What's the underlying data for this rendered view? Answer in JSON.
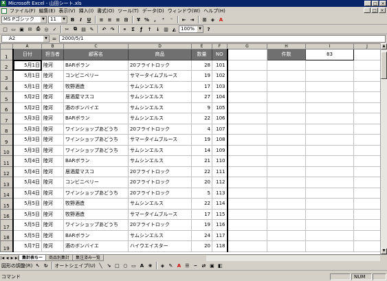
{
  "window": {
    "title": "Microsoft Excel - 山田シート.xls",
    "app_icon": "X"
  },
  "menu": [
    "ファイル(F)",
    "編集(E)",
    "表示(V)",
    "挿入(I)",
    "書式(O)",
    "ツール(T)",
    "データ(D)",
    "ウィンドウ(W)",
    "ヘルプ(H)"
  ],
  "toolbar": {
    "font_name": "MS Pゴシック",
    "font_size": "11",
    "bold": "B",
    "italic": "I",
    "underline": "U",
    "zoom": "100%"
  },
  "formula": {
    "name_box": "A2",
    "eq": "=",
    "value": "2000/5/1"
  },
  "columns": [
    "A",
    "B",
    "C",
    "D",
    "E",
    "F",
    "G",
    "H",
    "I",
    "J"
  ],
  "headers": {
    "date": "日付",
    "staff": "担当者",
    "customer": "顧客名",
    "product": "商品",
    "qty": "数量",
    "no": "NO"
  },
  "summary": {
    "label": "件数",
    "value": "83"
  },
  "rows": [
    {
      "r": "1"
    },
    {
      "r": "2",
      "date": "5月1日",
      "staff": "陸河",
      "customer": "BARボラン",
      "product": "20フライトロック",
      "qty": "28",
      "no": "101"
    },
    {
      "r": "3",
      "date": "5月1日",
      "staff": "陸河",
      "customer": "コンビニベリー",
      "product": "サマータイムブルース",
      "qty": "19",
      "no": "102"
    },
    {
      "r": "4",
      "date": "5月1日",
      "staff": "陸河",
      "customer": "牧野酒造",
      "product": "サムシンエルス",
      "qty": "17",
      "no": "103"
    },
    {
      "r": "5",
      "date": "5月2日",
      "staff": "陸河",
      "customer": "居酒屋マスコ",
      "product": "サムシンエルス",
      "qty": "27",
      "no": "104"
    },
    {
      "r": "6",
      "date": "5月2日",
      "staff": "陸河",
      "customer": "酒のボンバイエ",
      "product": "サムシンエルス",
      "qty": "9",
      "no": "105"
    },
    {
      "r": "7",
      "date": "5月3日",
      "staff": "陸河",
      "customer": "BARボラン",
      "product": "サムシンエルス",
      "qty": "22",
      "no": "106"
    },
    {
      "r": "8",
      "date": "5月3日",
      "staff": "陸河",
      "customer": "ワインショップあどうち",
      "product": "20フライトロック",
      "qty": "4",
      "no": "107"
    },
    {
      "r": "9",
      "date": "5月3日",
      "staff": "陸河",
      "customer": "ワインショップあどうち",
      "product": "サマータイムブルース",
      "qty": "19",
      "no": "108"
    },
    {
      "r": "10",
      "date": "5月3日",
      "staff": "陸河",
      "customer": "ワインショップあどうち",
      "product": "サムシンエルス",
      "qty": "14",
      "no": "109"
    },
    {
      "r": "11",
      "date": "5月4日",
      "staff": "陸河",
      "customer": "BARボラン",
      "product": "サムシンエルス",
      "qty": "21",
      "no": "110"
    },
    {
      "r": "12",
      "date": "5月4日",
      "staff": "陸河",
      "customer": "居酒屋マスコ",
      "product": "20フライトロック",
      "qty": "22",
      "no": "111"
    },
    {
      "r": "13",
      "date": "5月4日",
      "staff": "陸河",
      "customer": "コンビニベリー",
      "product": "20フライトロック",
      "qty": "20",
      "no": "112"
    },
    {
      "r": "14",
      "date": "5月4日",
      "staff": "陸河",
      "customer": "ワインショップあどうち",
      "product": "20フライトロック",
      "qty": "5",
      "no": "113"
    },
    {
      "r": "15",
      "date": "5月5日",
      "staff": "陸河",
      "customer": "牧野酒造",
      "product": "サムシンエルス",
      "qty": "22",
      "no": "114"
    },
    {
      "r": "16",
      "date": "5月5日",
      "staff": "陸河",
      "customer": "牧野酒造",
      "product": "サマータイムブルース",
      "qty": "17",
      "no": "115"
    },
    {
      "r": "17",
      "date": "5月5日",
      "staff": "陸河",
      "customer": "ワインショップあどうち",
      "product": "20フライトロック",
      "qty": "19",
      "no": "116"
    },
    {
      "r": "18",
      "date": "5月5日",
      "staff": "陸河",
      "customer": "BARボラン",
      "product": "サムシンエルス",
      "qty": "24",
      "no": "117"
    },
    {
      "r": "19",
      "date": "5月7日",
      "staff": "陸河",
      "customer": "酒のボンバイエ",
      "product": "ハイウエイスター",
      "qty": "20",
      "no": "118"
    }
  ],
  "tabs": [
    "集計表ちー",
    "商品別集計",
    "集注済み一覧"
  ],
  "drawing": {
    "draw_label": "図形の調整(R)",
    "autoshape_label": "オートシェイプ(U)"
  },
  "status": {
    "text": "コマンド",
    "num": "NUM"
  }
}
